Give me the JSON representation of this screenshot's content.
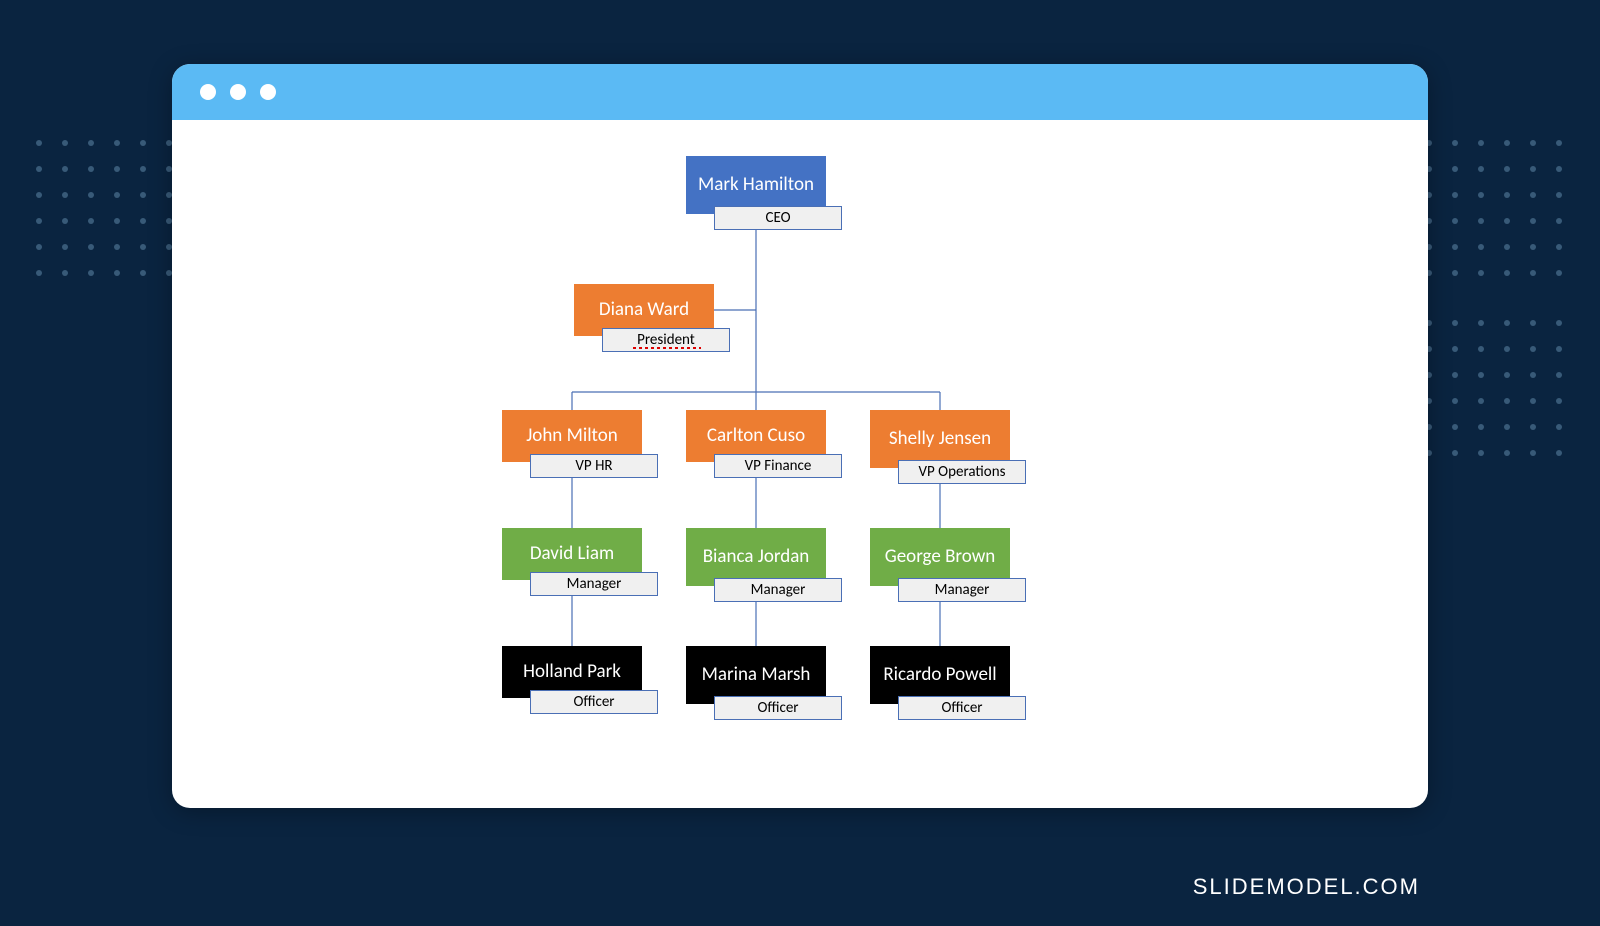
{
  "watermark": "SLIDEMODEL.COM",
  "chart_data": {
    "type": "org-chart",
    "nodes": [
      {
        "id": "ceo",
        "name": "Mark Hamilton",
        "title": "CEO",
        "color": "blue",
        "level": 0
      },
      {
        "id": "president",
        "name": "Diana Ward",
        "title": "President",
        "color": "orange",
        "level": 1,
        "assistant_to": "ceo",
        "spellcheck_flag": true
      },
      {
        "id": "vp-hr",
        "name": "John Milton",
        "title": "VP HR",
        "color": "orange",
        "level": 2,
        "parent": "ceo"
      },
      {
        "id": "vp-fin",
        "name": "Carlton Cuso",
        "title": "VP Finance",
        "color": "orange",
        "level": 2,
        "parent": "ceo"
      },
      {
        "id": "vp-ops",
        "name": "Shelly Jensen",
        "title": "VP Operations",
        "color": "orange",
        "level": 2,
        "parent": "ceo"
      },
      {
        "id": "mgr-hr",
        "name": "David Liam",
        "title": "Manager",
        "color": "green",
        "level": 3,
        "parent": "vp-hr"
      },
      {
        "id": "mgr-fin",
        "name": "Bianca Jordan",
        "title": "Manager",
        "color": "green",
        "level": 3,
        "parent": "vp-fin"
      },
      {
        "id": "mgr-ops",
        "name": "George Brown",
        "title": "Manager",
        "color": "green",
        "level": 3,
        "parent": "vp-ops"
      },
      {
        "id": "off-hr",
        "name": "Holland Park",
        "title": "Officer",
        "color": "black",
        "level": 4,
        "parent": "mgr-hr"
      },
      {
        "id": "off-fin",
        "name": "Marina Marsh",
        "title": "Officer",
        "color": "black",
        "level": 4,
        "parent": "mgr-fin"
      },
      {
        "id": "off-ops",
        "name": "Ricardo Powell",
        "title": "Officer",
        "color": "black",
        "level": 4,
        "parent": "mgr-ops"
      }
    ]
  }
}
